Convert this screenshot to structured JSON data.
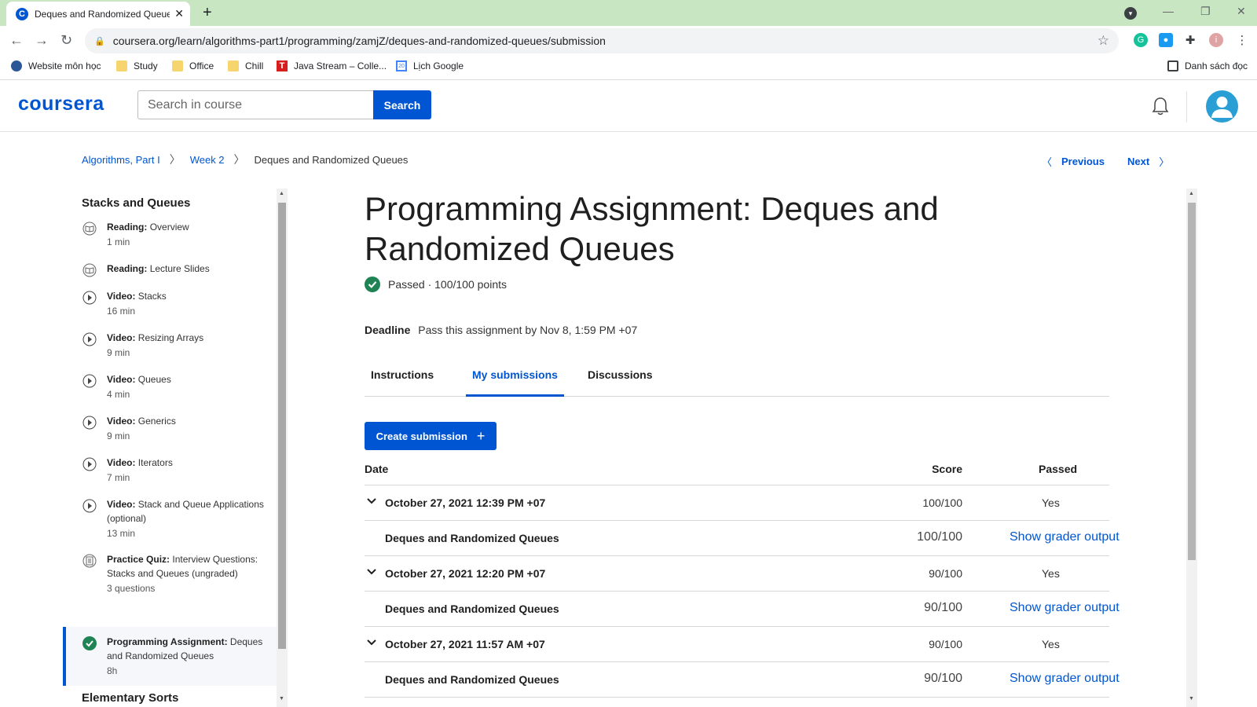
{
  "browser": {
    "tab_title": "Deques and Randomized Queues",
    "favicon_letter": "C",
    "url": "coursera.org/learn/algorithms-part1/programming/zamjZ/deques-and-randomized-queues/submission",
    "bookmarks": [
      {
        "label": "Website môn học",
        "icon": "globe-icon"
      },
      {
        "label": "Study",
        "icon": "folder-icon"
      },
      {
        "label": "Office",
        "icon": "folder-icon"
      },
      {
        "label": "Chill",
        "icon": "folder-icon"
      },
      {
        "label": "Java Stream – Colle...",
        "icon": "java-icon"
      },
      {
        "label": "Lịch Google",
        "icon": "calendar-icon"
      }
    ],
    "reading_list": "Danh sách đọc",
    "calendar_badge": "20",
    "java_badge": "T"
  },
  "header": {
    "logo": "coursera",
    "search_placeholder": "Search in course",
    "search_button": "Search"
  },
  "breadcrumb": {
    "course": "Algorithms, Part I",
    "week": "Week 2",
    "current": "Deques and Randomized Queues"
  },
  "nav": {
    "previous": "Previous",
    "next": "Next"
  },
  "sidebar": {
    "section": "Stacks and Queues",
    "items": [
      {
        "type": "Reading:",
        "name": "Overview",
        "duration": "1 min",
        "icon": "reading-icon"
      },
      {
        "type": "Reading:",
        "name": "Lecture Slides",
        "duration": "",
        "icon": "reading-icon"
      },
      {
        "type": "Video:",
        "name": "Stacks",
        "duration": "16 min",
        "icon": "play-icon"
      },
      {
        "type": "Video:",
        "name": "Resizing Arrays",
        "duration": "9 min",
        "icon": "play-icon"
      },
      {
        "type": "Video:",
        "name": "Queues",
        "duration": "4 min",
        "icon": "play-icon"
      },
      {
        "type": "Video:",
        "name": "Generics",
        "duration": "9 min",
        "icon": "play-icon"
      },
      {
        "type": "Video:",
        "name": "Iterators",
        "duration": "7 min",
        "icon": "play-icon"
      },
      {
        "type": "Video:",
        "name": "Stack and Queue Applications (optional)",
        "duration": "13 min",
        "icon": "play-icon"
      },
      {
        "type": "Practice Quiz:",
        "name": "Interview Questions: Stacks and Queues (ungraded)",
        "duration": "3 questions",
        "icon": "quiz-icon"
      },
      {
        "type": "Programming Assignment:",
        "name": "Deques and Randomized Queues",
        "duration": "8h",
        "icon": "check-icon"
      }
    ],
    "next_section": "Elementary Sorts"
  },
  "main": {
    "title": "Programming Assignment: Deques and Randomized Queues",
    "status": "Passed · 100/100 points",
    "deadline_label": "Deadline",
    "deadline_text": "Pass this assignment by Nov 8, 1:59 PM +07",
    "tabs": [
      "Instructions",
      "My submissions",
      "Discussions"
    ],
    "create_button": "Create submission",
    "table": {
      "headers": {
        "date": "Date",
        "score": "Score",
        "passed": "Passed"
      },
      "submissions": [
        {
          "date": "October 27, 2021 12:39 PM +07",
          "score": "100/100",
          "passed": "Yes",
          "part": "Deques and Randomized Queues",
          "part_score": "100/100",
          "link": "Show grader output"
        },
        {
          "date": "October 27, 2021 12:20 PM +07",
          "score": "90/100",
          "passed": "Yes",
          "part": "Deques and Randomized Queues",
          "part_score": "90/100",
          "link": "Show grader output"
        },
        {
          "date": "October 27, 2021 11:57 AM +07",
          "score": "90/100",
          "passed": "Yes",
          "part": "Deques and Randomized Queues",
          "part_score": "90/100",
          "link": "Show grader output"
        }
      ]
    }
  },
  "colors": {
    "accent": "#0056d2",
    "success": "#1f8354",
    "chrome_tabbar": "#c8e6c2"
  }
}
